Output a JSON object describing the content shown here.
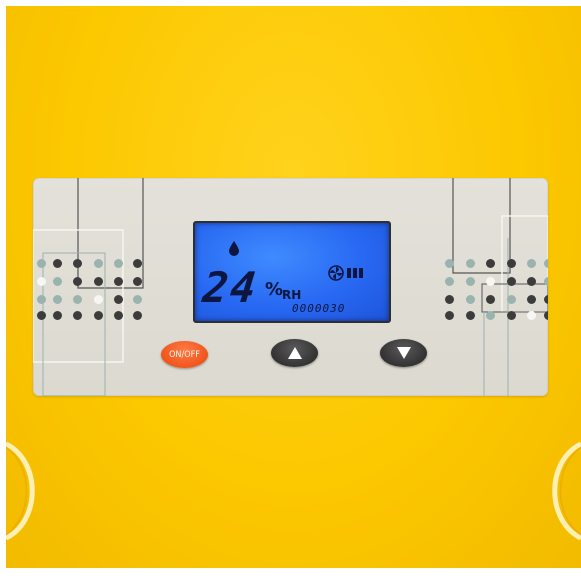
{
  "display": {
    "humidity_value": "24",
    "humidity_percent": "%",
    "humidity_unit": "RH",
    "secondary_digits": "0000030",
    "backlight_color": "#2f72ff"
  },
  "icons": {
    "water_drop": "water-drop-icon",
    "fan_speed": "fan-speed-icon",
    "up_arrow": "up-arrow-icon",
    "down_arrow": "down-arrow-icon"
  },
  "controls": {
    "power_label": "ON/OFF",
    "up_label": "",
    "down_label": ""
  },
  "colors": {
    "body": "#fcc800",
    "panel": "#dedbd2",
    "power_button": "#f0561c",
    "arrow_buttons": "#333333"
  }
}
